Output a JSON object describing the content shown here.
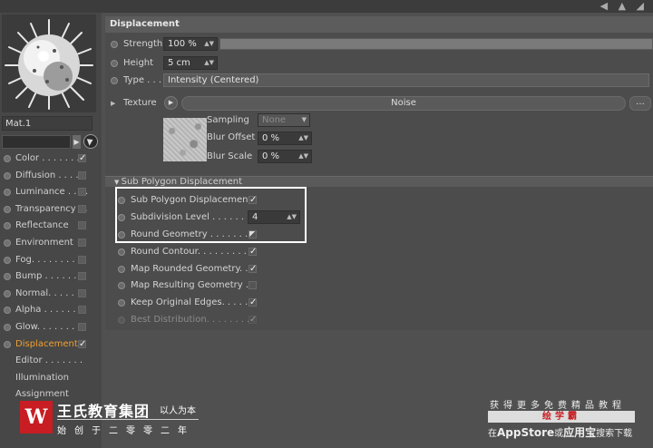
{
  "left": {
    "material_name": "Mat.1",
    "channels": [
      {
        "label": "Color . . . . . . .",
        "checked": true,
        "active": false
      },
      {
        "label": "Diffusion . . . . .",
        "checked": false,
        "active": false
      },
      {
        "label": "Luminance . . . .",
        "checked": false,
        "active": false
      },
      {
        "label": "Transparency . .",
        "checked": false,
        "active": false
      },
      {
        "label": "Reflectance",
        "checked": false,
        "active": false
      },
      {
        "label": "Environment",
        "checked": false,
        "active": false
      },
      {
        "label": "Fog. . . . . . . . .",
        "checked": false,
        "active": false
      },
      {
        "label": "Bump . . . . . . .",
        "checked": false,
        "active": false
      },
      {
        "label": "Normal. . . . . . .",
        "checked": false,
        "active": false
      },
      {
        "label": "Alpha . . . . . . .",
        "checked": false,
        "active": false
      },
      {
        "label": "Glow. . . . . . . .",
        "checked": false,
        "active": false
      },
      {
        "label": "Displacement",
        "checked": true,
        "active": true
      },
      {
        "label": "Editor . . . . . . .",
        "checked": null,
        "active": false
      },
      {
        "label": "Illumination",
        "checked": null,
        "active": false
      },
      {
        "label": "Assignment",
        "checked": null,
        "active": false
      }
    ]
  },
  "panel": {
    "title": "Displacement",
    "strength_label": "Strength",
    "strength_value": "100 %",
    "strength_fraction": 1.0,
    "height_label": "Height",
    "height_value": "5 cm",
    "type_label": "Type . . .",
    "type_value": "Intensity (Centered)",
    "texture_label": "Texture",
    "texture_name": "Noise",
    "texture_more": "...",
    "sampling_label": "Sampling",
    "sampling_value": "None",
    "blur_offset_label": "Blur Offset",
    "blur_offset_value": "0 %",
    "blur_scale_label": "Blur Scale",
    "blur_scale_value": "0 %",
    "sub_header": "Sub Polygon Displacement",
    "spd_label": "Sub Polygon Displacement",
    "subdiv_label": "Subdivision Level . . . . . . . .",
    "subdiv_value": "4",
    "round_geo_label": "Round Geometry . . . . . . . .",
    "round_contour_label": "Round Contour. . . . . . . . . .",
    "map_rounded_label": "Map Rounded Geometry. .",
    "map_result_label": "Map Resulting Geometry . .",
    "keep_edges_label": "Keep Original Edges. . . . . .",
    "best_dist_label": "Best Distribution. . . . . . . . ."
  },
  "watermark": {
    "logo_letter": "W",
    "company": "王氏教育集团",
    "tagline": "以人为本",
    "sub": "始创于二零零二年",
    "right_line1": "获得更多免费精品教程",
    "right_box": "绘学霸",
    "right_line2_pre": "在",
    "right_line2_app": "AppStore",
    "right_line2_mid": "或",
    "right_line2_bold": "应用宝",
    "right_line2_post": "搜索下载"
  }
}
